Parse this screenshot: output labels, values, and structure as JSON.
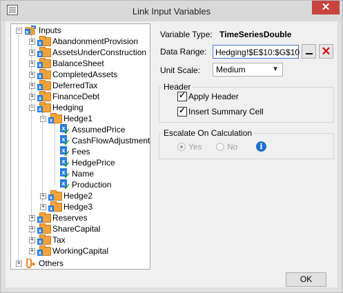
{
  "window": {
    "title": "Link Input Variables",
    "close_glyph": "✕"
  },
  "tree": {
    "root": {
      "label": "Inputs"
    },
    "inputs_children": [
      {
        "label": "AbandonmentProvision"
      },
      {
        "label": "AssetsUnderConstruction"
      },
      {
        "label": "BalanceSheet"
      },
      {
        "label": "CompletedAssets"
      },
      {
        "label": "DeferredTax"
      },
      {
        "label": "FinanceDebt"
      },
      {
        "label": "Hedging"
      }
    ],
    "hedge1": {
      "label": "Hedge1"
    },
    "hedge1_children": [
      {
        "label": "AssumedPrice"
      },
      {
        "label": "CashFlowAdjustment"
      },
      {
        "label": "Fees"
      },
      {
        "label": "HedgePrice"
      },
      {
        "label": "Name"
      },
      {
        "label": "Production"
      }
    ],
    "hedge2": {
      "label": "Hedge2"
    },
    "hedge3": {
      "label": "Hedge3"
    },
    "after_hedging": [
      {
        "label": "Reserves"
      },
      {
        "label": "ShareCapital"
      },
      {
        "label": "Tax"
      },
      {
        "label": "WorkingCapital"
      }
    ],
    "others": {
      "label": "Others"
    }
  },
  "form": {
    "variable_type_label": "Variable Type:",
    "variable_type_value": "TimeSeriesDouble",
    "data_range_label": "Data Range:",
    "data_range_value": "Hedging!$E$10:$G$10",
    "unit_scale_label": "Unit Scale:",
    "unit_scale_value": "Medium",
    "header_group": "Header",
    "apply_header": "Apply Header",
    "insert_summary": "Insert Summary Cell",
    "escalate_group": "Escalate On Calculation",
    "yes": "Yes",
    "no": "No",
    "info_glyph": "i"
  },
  "buttons": {
    "ok": "OK"
  },
  "colors": {
    "folder": "#f4a33a",
    "variable_icon": "#2b7bdc",
    "check": "#1a9a2a",
    "remove": "#d0151d",
    "close": "#c7443f"
  }
}
